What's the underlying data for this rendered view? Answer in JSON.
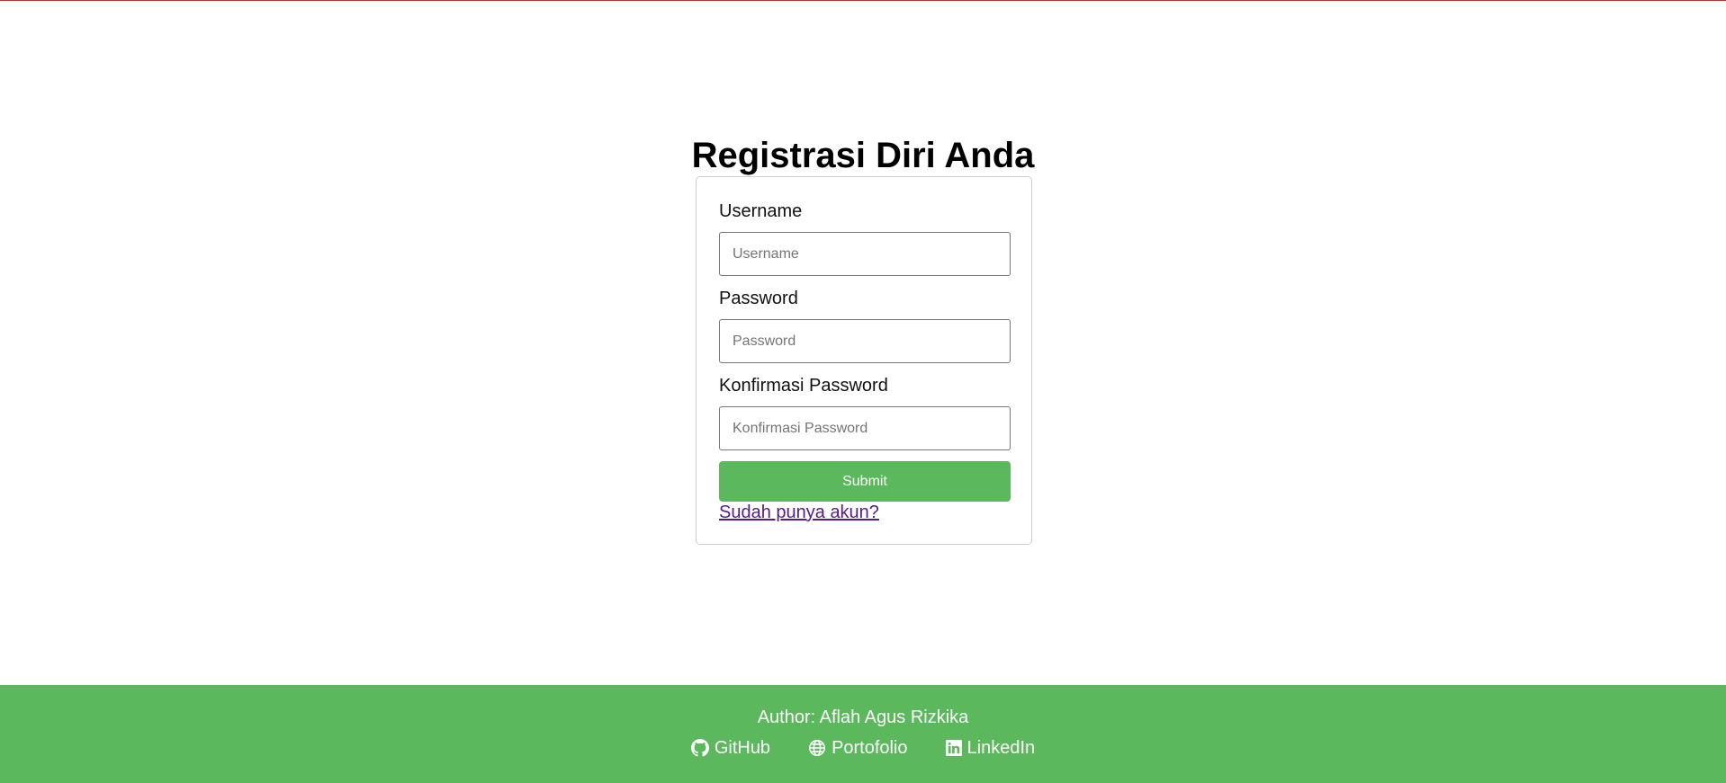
{
  "page": {
    "title": "Registrasi Diri Anda"
  },
  "form": {
    "username_label": "Username",
    "username_placeholder": "Username",
    "password_label": "Password",
    "password_placeholder": "Password",
    "confirm_label": "Konfirmasi Password",
    "confirm_placeholder": "Konfirmasi Password",
    "submit_label": "Submit",
    "login_link": "Sudah punya akun?"
  },
  "footer": {
    "author": "Author: Aflah Agus Rizkika",
    "links": [
      {
        "label": "GitHub",
        "icon": "github-icon"
      },
      {
        "label": "Portofolio",
        "icon": "globe-icon"
      },
      {
        "label": "LinkedIn",
        "icon": "linkedin-icon"
      }
    ]
  },
  "colors": {
    "accent": "#5cb85c",
    "link_visited": "#551a8b",
    "top_line": "#b5302f"
  }
}
